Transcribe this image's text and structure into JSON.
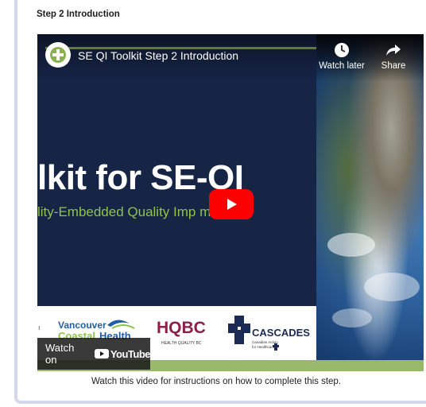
{
  "step": {
    "heading": "Step 2 Introduction"
  },
  "video": {
    "title": "SE QI Toolkit Step 2 Introduction",
    "slide_title": "lkit for SE-QI",
    "slide_subtitle": "lity-Embedded Quality Imp     ment",
    "watch_later": "Watch later",
    "share": "Share",
    "watch_on": "Watch on",
    "youtube": "YouTube",
    "logos": {
      "vch_line1": "Vancouver",
      "vch_line2a": "Coastal",
      "vch_line2b": "Health",
      "hqbc": "HQBC",
      "hqbc_sub": "HEALTH QUALITY BC",
      "cascades": "CASCADES",
      "cascades_sub1": "Canadian Action",
      "cascades_sub2": "for Healthcare"
    }
  },
  "caption": "Watch this video for instructions on how to complete this step.",
  "colors": {
    "slide_bg": "#162446",
    "accent_green": "#8bb04f",
    "play_red": "#ff0000",
    "card_border": "#d3d8ea"
  },
  "icons": [
    "channel-logo-icon",
    "clock-icon",
    "share-icon",
    "play-icon",
    "youtube-logo-icon"
  ]
}
